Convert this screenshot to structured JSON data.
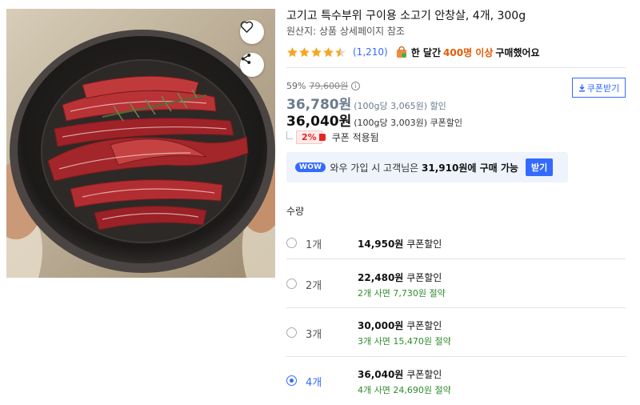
{
  "product": {
    "title": "고기고 특수부위 구이용 소고기 안창살, 4개, 300g",
    "origin": "원산지: 상품 상세페이지 참조",
    "rating": 4.5,
    "review_count": "(1,210)",
    "buy_prefix": "한 달간",
    "buy_count": "400명 이상",
    "buy_suffix": "구매했어요"
  },
  "icons": {
    "like": "heart-icon",
    "share": "share-icon",
    "bag": "shopping-bag-icon",
    "info": "info-icon",
    "download": "download-icon"
  },
  "price": {
    "discount_rate": "59%",
    "original": "79,600원",
    "sale": "36,780원",
    "sale_unit": "(100g당 3,065원) 할인",
    "coupon": "36,040원",
    "coupon_unit": "(100g당 3,003원) 쿠폰할인",
    "coupon_pct": "2%",
    "coupon_applied": "쿠폰 적용됨",
    "coupon_button": "쿠폰받기",
    "info_glyph": "i"
  },
  "wow": {
    "badge": "WOW",
    "text_prefix": "와우 가입 시 고객님은",
    "text_price": "31,910원에 구매 가능",
    "button": "받기"
  },
  "quantity": {
    "label": "수량",
    "options": [
      {
        "qty": "1개",
        "price": "14,950원",
        "price_suffix": "쿠폰할인",
        "save": "",
        "selected": false
      },
      {
        "qty": "2개",
        "price": "22,480원",
        "price_suffix": "쿠폰할인",
        "save": "2개 사면 7,730원 절약",
        "selected": false
      },
      {
        "qty": "3개",
        "price": "30,000원",
        "price_suffix": "쿠폰할인",
        "save": "3개 사면 15,470원 절약",
        "selected": false
      },
      {
        "qty": "4개",
        "price": "36,040원",
        "price_suffix": "쿠폰할인",
        "save": "4개 사면 24,690원 절약",
        "selected": true
      }
    ]
  },
  "colors": {
    "accent": "#346aff",
    "star": "#f5a623",
    "discount_red": "#e52528",
    "save_green": "#2e8b2e",
    "buy_orange": "#e65a05"
  }
}
